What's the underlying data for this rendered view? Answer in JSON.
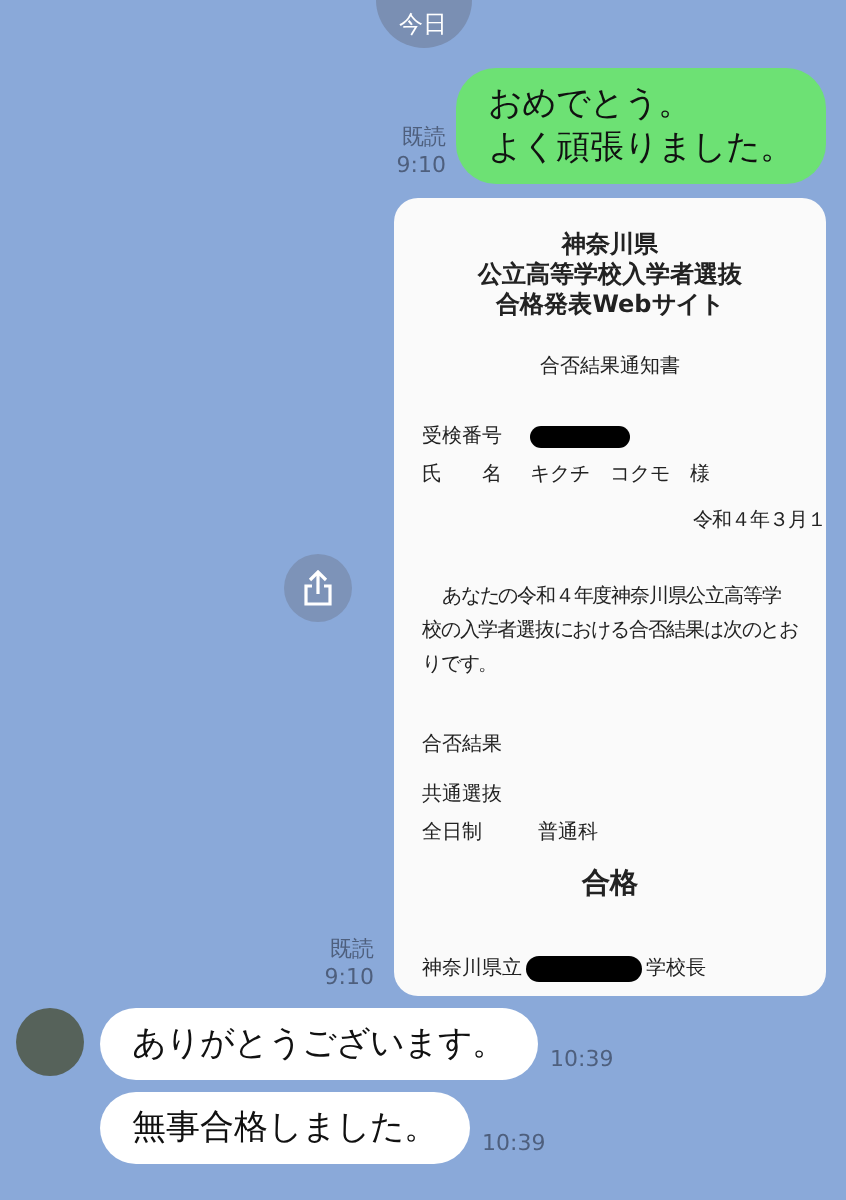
{
  "date_divider": "今日",
  "messages": [
    {
      "kind": "outgoing_text",
      "read_label": "既読",
      "time": "9:10",
      "lines": [
        "おめでとう。",
        "よく頑張りました。"
      ]
    },
    {
      "kind": "document",
      "read_label": "既読",
      "time": "9:10",
      "share_button": true,
      "document": {
        "title_lines": [
          "神奈川県",
          "公立高等学校入学者選抜",
          "合格発表Webサイト"
        ],
        "subtitle": "合否結果通知書",
        "exam_number": {
          "label": "受検番号",
          "redacted": true
        },
        "name": {
          "label": "氏　　名",
          "value": "キクチ　コクモ　様"
        },
        "date": "令和４年３月１",
        "paragraph": "あなたの令和４年度神奈川県公立高等学校の入学者選抜における合否結果は次のとおりです。",
        "result_heading": "合否結果",
        "selection": "共通選抜",
        "course": {
          "label": "全日制",
          "value": "普通科"
        },
        "result": "合格",
        "signature": {
          "prefix": "神奈川県立",
          "redacted": true,
          "suffix": "学校長"
        }
      }
    },
    {
      "kind": "incoming_text",
      "time": "10:39",
      "lines": [
        "ありがとうございます。"
      ],
      "show_avatar": true
    },
    {
      "kind": "incoming_text",
      "time": "10:39",
      "lines": [
        "無事合格しました。"
      ],
      "show_avatar": false
    }
  ]
}
